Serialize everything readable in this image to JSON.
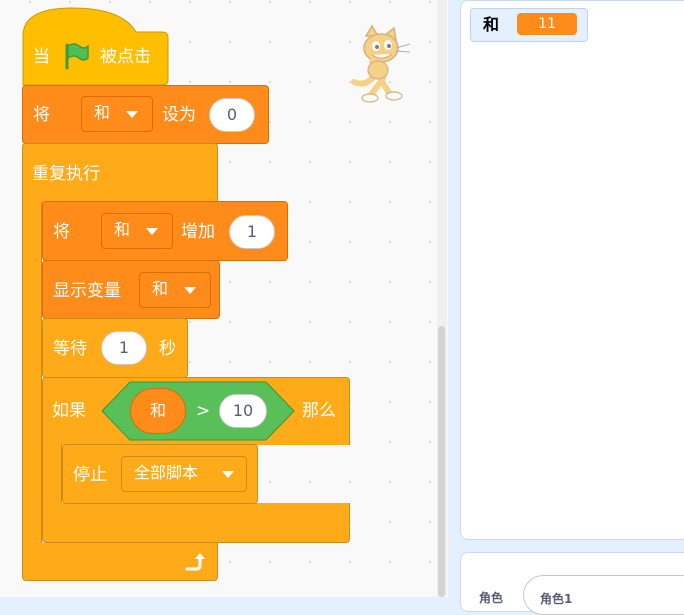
{
  "blocks": {
    "hat": {
      "label_when": "当",
      "label_clicked": "被点击",
      "icon": "green-flag-icon"
    },
    "set_var": {
      "label": "将",
      "variable": "和",
      "label_to": "设为",
      "value": "0"
    },
    "forever": {
      "label": "重复执行",
      "icon": "loop-arrow-icon"
    },
    "change_var": {
      "label": "将",
      "variable": "和",
      "label_by": "增加",
      "value": "1"
    },
    "show_var": {
      "label": "显示变量",
      "variable": "和"
    },
    "wait": {
      "label": "等待",
      "value": "1",
      "unit": "秒"
    },
    "if": {
      "label_if": "如果",
      "left": "和",
      "operator": ">",
      "right": "10",
      "label_then": "那么"
    },
    "stop": {
      "label": "停止",
      "option": "全部脚本"
    }
  },
  "monitor": {
    "name": "和",
    "value": "11"
  },
  "sprite_info": {
    "label": "角色",
    "name": "角色1"
  },
  "colors": {
    "events": "#ffbf00",
    "control": "#ffab19",
    "variables": "#ff8c1a",
    "operators": "#59c059",
    "flag": "#4cbf56",
    "panel_bg": "#e5f0ff"
  }
}
